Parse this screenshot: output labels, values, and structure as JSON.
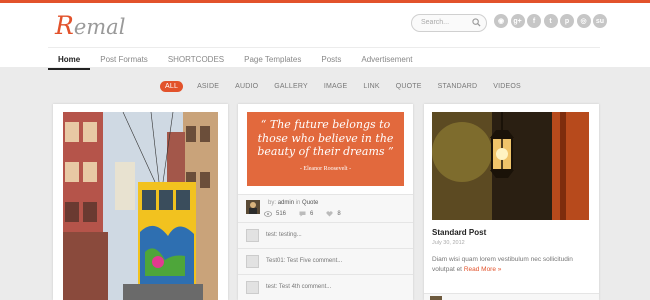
{
  "header": {
    "logo_first": "R",
    "logo_rest": "emal",
    "search_placeholder": "Search...",
    "social_icons": [
      {
        "name": "rss-icon",
        "glyph": "◉"
      },
      {
        "name": "google-plus-icon",
        "glyph": "g+"
      },
      {
        "name": "facebook-icon",
        "glyph": "f"
      },
      {
        "name": "twitter-icon",
        "glyph": "t"
      },
      {
        "name": "pinterest-icon",
        "glyph": "p"
      },
      {
        "name": "dribbble-icon",
        "glyph": "◎"
      },
      {
        "name": "stumbleupon-icon",
        "glyph": "su"
      }
    ],
    "accent": "#e2522b"
  },
  "nav": {
    "items": [
      "Home",
      "Post Formats",
      "SHORTCODES",
      "Page Templates",
      "Posts",
      "Advertisement"
    ],
    "active": "Home"
  },
  "filter": {
    "items": [
      "ALL",
      "ASIDE",
      "AUDIO",
      "GALLERY",
      "IMAGE",
      "LINK",
      "QUOTE",
      "STANDARD",
      "VIDEOS"
    ],
    "active": "ALL"
  },
  "quote_card": {
    "quote": "“ The future belongs to those who believe in the beauty of their dreams ”",
    "author": "- Eleanor Roosevelt -",
    "by_prefix": "by:",
    "author_name": "admin",
    "in_prefix": "in",
    "category": "Quote",
    "views": "516",
    "comments": "6",
    "likes": "8",
    "recent_comments": [
      "test: testing...",
      "Test01: Test Five comment...",
      "test: Test 4th comment..."
    ]
  },
  "standard_card": {
    "title": "Standard Post",
    "date": "July 30, 2012",
    "excerpt": "Diam wisi quam lorem vestibulum nec sollicitudin volutpat et ",
    "read_more": "Read More »"
  }
}
